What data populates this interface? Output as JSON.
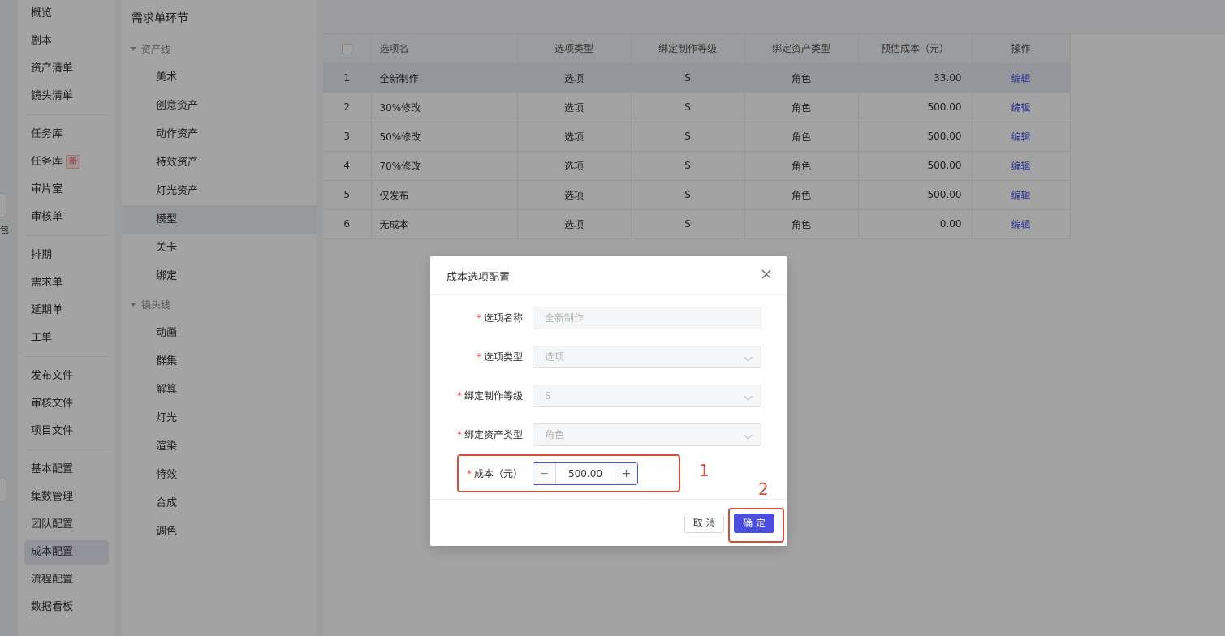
{
  "nav": {
    "items": [
      {
        "label": "概览"
      },
      {
        "label": "剧本"
      },
      {
        "label": "资产清单"
      },
      {
        "label": "镜头清单"
      },
      {
        "label": "任务库"
      },
      {
        "label": "任务库",
        "badge": "新"
      },
      {
        "label": "审片室"
      },
      {
        "label": "审核单"
      },
      {
        "label": "排期"
      },
      {
        "label": "需求单"
      },
      {
        "label": "延期单"
      },
      {
        "label": "工单"
      },
      {
        "label": "发布文件"
      },
      {
        "label": "审核文件"
      },
      {
        "label": "项目文件"
      },
      {
        "label": "基本配置"
      },
      {
        "label": "集数管理"
      },
      {
        "label": "团队配置"
      },
      {
        "label": "成本配置",
        "active": true
      },
      {
        "label": "流程配置"
      },
      {
        "label": "数据看板"
      }
    ],
    "left_fragment": "包"
  },
  "stages": {
    "title": "需求单环节",
    "groups": [
      {
        "label": "资产线",
        "items": [
          "美术",
          "创意资产",
          "动作资产",
          "特效资产",
          "灯光资产",
          "模型",
          "关卡",
          "绑定"
        ]
      },
      {
        "label": "镜头线",
        "items": [
          "动画",
          "群集",
          "解算",
          "灯光",
          "渲染",
          "特效",
          "合成",
          "调色"
        ]
      }
    ],
    "active": "模型"
  },
  "table": {
    "columns": [
      "",
      "选项名",
      "选项类型",
      "绑定制作等级",
      "绑定资产类型",
      "预估成本（元）",
      "操作"
    ],
    "rows": [
      {
        "no": "1",
        "name": "全新制作",
        "type": "选项",
        "level": "S",
        "asset": "角色",
        "cost": "33.00",
        "action": "编辑"
      },
      {
        "no": "2",
        "name": "30%修改",
        "type": "选项",
        "level": "S",
        "asset": "角色",
        "cost": "500.00",
        "action": "编辑"
      },
      {
        "no": "3",
        "name": "50%修改",
        "type": "选项",
        "level": "S",
        "asset": "角色",
        "cost": "500.00",
        "action": "编辑"
      },
      {
        "no": "4",
        "name": "70%修改",
        "type": "选项",
        "level": "S",
        "asset": "角色",
        "cost": "500.00",
        "action": "编辑"
      },
      {
        "no": "5",
        "name": "仅发布",
        "type": "选项",
        "level": "S",
        "asset": "角色",
        "cost": "500.00",
        "action": "编辑"
      },
      {
        "no": "6",
        "name": "无成本",
        "type": "选项",
        "level": "S",
        "asset": "角色",
        "cost": "0.00",
        "action": "编辑"
      }
    ]
  },
  "modal": {
    "title": "成本选项配置",
    "fields": {
      "name": {
        "label": "选项名称",
        "value": "全新制作"
      },
      "type": {
        "label": "选项类型",
        "value": "选项"
      },
      "level": {
        "label": "绑定制作等级",
        "value": "S"
      },
      "asset": {
        "label": "绑定资产类型",
        "value": "角色"
      },
      "cost": {
        "label": "成本（元）",
        "value": "500.00",
        "minus": "−",
        "plus": "+"
      }
    },
    "required_mark": "*",
    "cancel_label": "取 消",
    "ok_label": "确 定"
  },
  "annotations": {
    "one": "1",
    "two": "2"
  },
  "colors": {
    "primary": "#4a4ee0",
    "annotation": "#d94c3a",
    "link": "#3f51d8"
  }
}
